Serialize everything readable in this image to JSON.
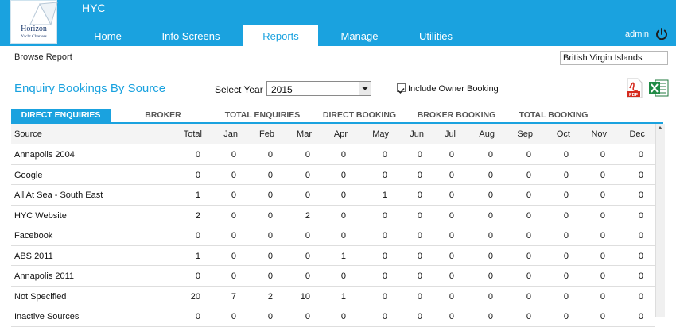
{
  "app": {
    "title": "HYC",
    "logo": {
      "name": "Horizon",
      "subtitle": "Yacht Charters"
    }
  },
  "nav": {
    "tabs": [
      {
        "label": "Home",
        "active": false
      },
      {
        "label": "Info Screens",
        "active": false
      },
      {
        "label": "Reports",
        "active": true
      },
      {
        "label": "Manage",
        "active": false
      },
      {
        "label": "Utilities",
        "active": false
      }
    ],
    "user": "admin"
  },
  "subheader": {
    "breadcrumb": "Browse Report",
    "region": "British Virgin Islands"
  },
  "report": {
    "title": "Enquiry Bookings By Source",
    "year_label": "Select Year",
    "year_value": "2015",
    "owner_label": "Include Owner Booking",
    "owner_checked": true,
    "pdf_icon": "pdf-icon",
    "excel_icon": "excel-icon"
  },
  "subtabs": [
    {
      "label": "DIRECT ENQUIRIES",
      "active": true
    },
    {
      "label": "BROKER ENQUIRIES",
      "active": false
    },
    {
      "label": "TOTAL ENQUIRIES",
      "active": false
    },
    {
      "label": "DIRECT BOOKING",
      "active": false
    },
    {
      "label": "BROKER BOOKING",
      "active": false
    },
    {
      "label": "TOTAL BOOKING",
      "active": false
    }
  ],
  "table": {
    "columns": [
      "Source",
      "Total",
      "Jan",
      "Feb",
      "Mar",
      "Apr",
      "May",
      "Jun",
      "Jul",
      "Aug",
      "Sep",
      "Oct",
      "Nov",
      "Dec"
    ],
    "rows": [
      {
        "source": "Annapolis 2004",
        "values": [
          "0",
          "0",
          "0",
          "0",
          "0",
          "0",
          "0",
          "0",
          "0",
          "0",
          "0",
          "0",
          "0"
        ]
      },
      {
        "source": "Google",
        "values": [
          "0",
          "0",
          "0",
          "0",
          "0",
          "0",
          "0",
          "0",
          "0",
          "0",
          "0",
          "0",
          "0"
        ]
      },
      {
        "source": "All At Sea - South East",
        "values": [
          "1",
          "0",
          "0",
          "0",
          "0",
          "1",
          "0",
          "0",
          "0",
          "0",
          "0",
          "0",
          "0"
        ]
      },
      {
        "source": "HYC Website",
        "values": [
          "2",
          "0",
          "0",
          "2",
          "0",
          "0",
          "0",
          "0",
          "0",
          "0",
          "0",
          "0",
          "0"
        ]
      },
      {
        "source": "Facebook",
        "values": [
          "0",
          "0",
          "0",
          "0",
          "0",
          "0",
          "0",
          "0",
          "0",
          "0",
          "0",
          "0",
          "0"
        ]
      },
      {
        "source": "ABS 2011",
        "values": [
          "1",
          "0",
          "0",
          "0",
          "1",
          "0",
          "0",
          "0",
          "0",
          "0",
          "0",
          "0",
          "0"
        ]
      },
      {
        "source": "Annapolis 2011",
        "values": [
          "0",
          "0",
          "0",
          "0",
          "0",
          "0",
          "0",
          "0",
          "0",
          "0",
          "0",
          "0",
          "0"
        ]
      },
      {
        "source": "Not Specified",
        "values": [
          "20",
          "7",
          "2",
          "10",
          "1",
          "0",
          "0",
          "0",
          "0",
          "0",
          "0",
          "0",
          "0"
        ]
      },
      {
        "source": "Inactive Sources",
        "values": [
          "0",
          "0",
          "0",
          "0",
          "0",
          "0",
          "0",
          "0",
          "0",
          "0",
          "0",
          "0",
          "0"
        ]
      }
    ]
  },
  "colors": {
    "accent": "#1aa2df",
    "header_bg": "#f4f4f4"
  }
}
